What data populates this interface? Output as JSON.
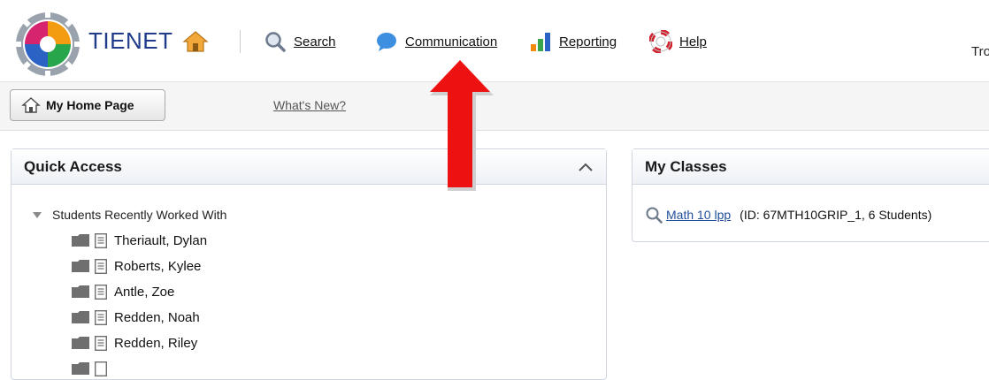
{
  "header": {
    "brand": "TIENET",
    "nav": [
      {
        "label": "Search",
        "icon": "magnifier-icon"
      },
      {
        "label": "Communication",
        "icon": "speech-bubble-icon"
      },
      {
        "label": "Reporting",
        "icon": "bar-chart-icon"
      },
      {
        "label": "Help",
        "icon": "lifebuoy-icon"
      }
    ],
    "user_partial": "Tro"
  },
  "subnav": {
    "home_page_label": "My Home Page",
    "whats_new_label": "What's New?"
  },
  "quick_access": {
    "title": "Quick Access",
    "group_label": "Students Recently Worked With",
    "students": [
      "Theriault, Dylan",
      "Roberts, Kylee",
      "Antle, Zoe",
      "Redden, Noah",
      "Redden, Riley"
    ]
  },
  "my_classes": {
    "title": "My Classes",
    "classes": [
      {
        "name": "Math 10 lpp",
        "meta": "(ID: 67MTH10GRIP_1, 6 Students)"
      }
    ]
  },
  "colors": {
    "arrow": "#ee1111",
    "link": "#1f4e9b",
    "brand": "#1f3b8a"
  }
}
